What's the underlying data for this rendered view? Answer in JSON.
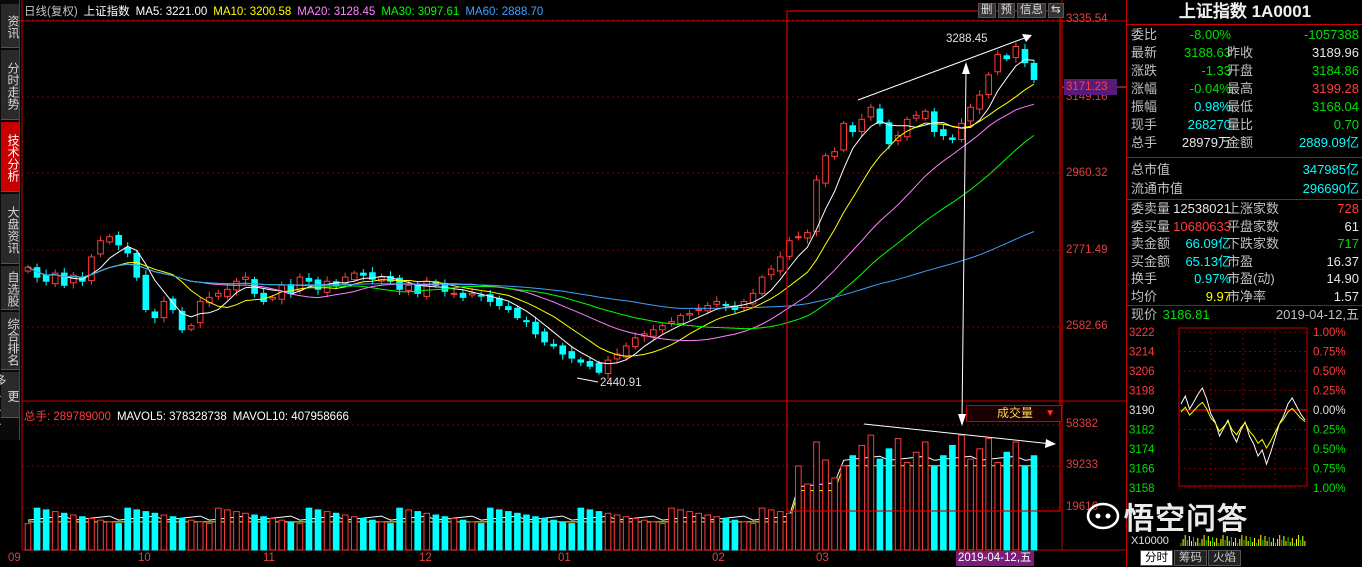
{
  "left_tabs": [
    "资讯",
    "分时走势",
    "技术分析",
    "大盘资讯",
    "自选股",
    "综合排名",
    "更多..."
  ],
  "active_left_tab": 2,
  "header": {
    "chart_type": "日线(复权)",
    "name": "上证指数",
    "ma5_label": "MA5: 3221.00",
    "ma10_label": "MA10: 3200.58",
    "ma20_label": "MA20: 3128.45",
    "ma30_label": "MA30: 3097.61",
    "ma60_label": "MA60: 2888.70"
  },
  "top_buttons": [
    "删",
    "预",
    "信息",
    "⇆"
  ],
  "price_axis": [
    "3335.54",
    "3149.16",
    "2960.32",
    "2771.49",
    "2582.66"
  ],
  "current_price_badge": "3171.23",
  "volume_axis": [
    "58382",
    "39233",
    "19616"
  ],
  "time_axis": [
    "09",
    "10",
    "11",
    "12",
    "01",
    "02",
    "03"
  ],
  "date_badge": "2019-04-12,五",
  "annotations": {
    "high": "3288.45",
    "low": "2440.91"
  },
  "volume_header": {
    "total": "总手: 289789000",
    "mavol5": "MAVOL5: 378328738",
    "mavol10": "MAVOL10: 407958666"
  },
  "volume_badge": "成交量",
  "colors": {
    "up": "#ff3c3c",
    "down": "#00ffff",
    "ma5": "#ffffff",
    "ma10": "#ffff00",
    "ma20": "#ff80ff",
    "ma30": "#00ff00",
    "ma60": "#40a0ff",
    "frame": "#e00000"
  },
  "chart_data": {
    "type": "candlestick",
    "ylim": [
      2440.91,
      3335.54
    ],
    "high": 3288.45,
    "low": 2440.91,
    "last_close": 3188.63,
    "x_months": [
      "09",
      "10",
      "11",
      "12",
      "01",
      "02",
      "03",
      "04"
    ],
    "candles_close": [
      2725,
      2700,
      2690,
      2710,
      2680,
      2705,
      2690,
      2750,
      2790,
      2800,
      2780,
      2760,
      2700,
      2620,
      2600,
      2640,
      2620,
      2570,
      2580,
      2640,
      2650,
      2660,
      2670,
      2690,
      2700,
      2660,
      2640,
      2650,
      2680,
      2660,
      2700,
      2690,
      2670,
      2690,
      2680,
      2700,
      2710,
      2705,
      2695,
      2700,
      2690,
      2670,
      2680,
      2660,
      2690,
      2680,
      2665,
      2660,
      2650,
      2660,
      2655,
      2640,
      2630,
      2620,
      2600,
      2590,
      2560,
      2540,
      2530,
      2510,
      2500,
      2490,
      2480,
      2465,
      2495,
      2510,
      2530,
      2550,
      2560,
      2570,
      2580,
      2590,
      2605,
      2610,
      2620,
      2630,
      2640,
      2630,
      2620,
      2640,
      2660,
      2700,
      2720,
      2750,
      2790,
      2800,
      2810,
      2940,
      3000,
      3010,
      3080,
      3060,
      3090,
      3120,
      3080,
      3030,
      3050,
      3090,
      3100,
      3110,
      3060,
      3050,
      3040,
      3080,
      3120,
      3150,
      3200,
      3250,
      3240,
      3270,
      3230,
      3188.63
    ]
  },
  "right_panel": {
    "title": "上证指数 1A0001",
    "rows": [
      [
        [
          "委比",
          "lbl"
        ],
        [
          "-8.00%",
          "grn"
        ],
        [
          "-1057388",
          "grn"
        ]
      ],
      [
        [
          "最新",
          "lbl"
        ],
        [
          "3188.63",
          "grn"
        ],
        [
          "昨收",
          "lbl"
        ],
        [
          "3189.96",
          "wht"
        ]
      ],
      [
        [
          "涨跌",
          "lbl"
        ],
        [
          "-1.33",
          "grn"
        ],
        [
          "开盘",
          "lbl"
        ],
        [
          "3184.86",
          "grn"
        ]
      ],
      [
        [
          "涨幅",
          "lbl"
        ],
        [
          "-0.04%",
          "grn"
        ],
        [
          "最高",
          "lbl"
        ],
        [
          "3199.28",
          "red"
        ]
      ],
      [
        [
          "振幅",
          "lbl"
        ],
        [
          "0.98%",
          "cyn"
        ],
        [
          "最低",
          "lbl"
        ],
        [
          "3168.04",
          "grn"
        ]
      ],
      [
        [
          "现手",
          "lbl"
        ],
        [
          "268270",
          "cyn"
        ],
        [
          "量比",
          "lbl"
        ],
        [
          "0.70",
          "grn"
        ]
      ],
      [
        [
          "总手",
          "lbl"
        ],
        [
          "28979万",
          "wht"
        ],
        [
          "金额",
          "lbl"
        ],
        [
          "2889.09亿",
          "cyn"
        ]
      ]
    ],
    "rows2": [
      [
        [
          "总市值",
          "lbl"
        ],
        [
          "347985亿",
          "cyn"
        ]
      ],
      [
        [
          "流通市值",
          "lbl"
        ],
        [
          "296690亿",
          "cyn"
        ]
      ]
    ],
    "rows3": [
      [
        [
          "委卖量",
          "lbl"
        ],
        [
          "12538021",
          "wht"
        ],
        [
          "上涨家数",
          "lbl"
        ],
        [
          "728",
          "red"
        ]
      ],
      [
        [
          "委买量",
          "lbl"
        ],
        [
          "10680633",
          "red"
        ],
        [
          "平盘家数",
          "lbl"
        ],
        [
          "61",
          "wht"
        ]
      ],
      [
        [
          "卖金额",
          "lbl"
        ],
        [
          "66.09亿",
          "cyn"
        ],
        [
          "下跌家数",
          "lbl"
        ],
        [
          "717",
          "grn"
        ]
      ],
      [
        [
          "买金额",
          "lbl"
        ],
        [
          "65.13亿",
          "cyn"
        ],
        [
          "市盈",
          "lbl"
        ],
        [
          "16.37",
          "wht"
        ]
      ],
      [
        [
          "换手",
          "lbl"
        ],
        [
          "0.97%",
          "cyn"
        ],
        [
          "市盈(动)",
          "lbl"
        ],
        [
          "14.90",
          "wht"
        ]
      ],
      [
        [
          "均价",
          "lbl"
        ],
        [
          "9.97",
          "yel"
        ],
        [
          "市净率",
          "lbl"
        ],
        [
          "1.57",
          "wht"
        ]
      ]
    ],
    "intraday_header_label": "现价",
    "intraday_header_price": "3186.81",
    "intraday_header_date": "2019-04-12,五",
    "intraday_prices": [
      "3222",
      "3214",
      "3206",
      "3198",
      "3190",
      "3182",
      "3174",
      "3166",
      "3158"
    ],
    "intraday_pcts": [
      "1.00%",
      "0.75%",
      "0.50%",
      "0.25%",
      "0.00%",
      "0.25%",
      "0.50%",
      "0.75%",
      "1.00%"
    ],
    "intraday_vol_label": "X10000",
    "bottom_tabs": [
      "分时",
      "筹码",
      "火焰"
    ]
  },
  "watermark": "悟空问答"
}
